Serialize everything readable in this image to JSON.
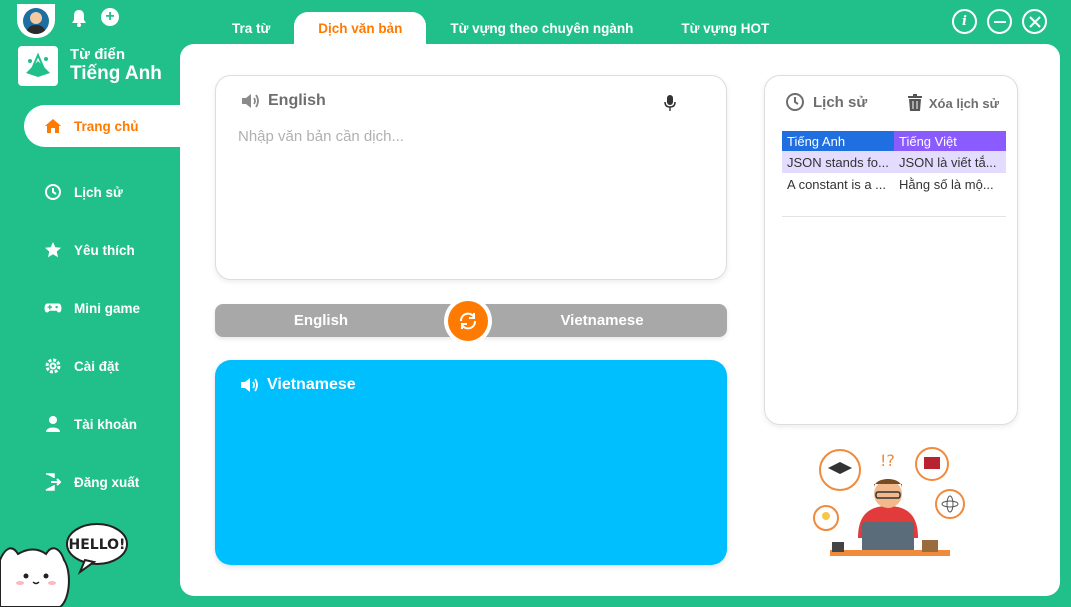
{
  "brand": {
    "line1": "Từ điển",
    "line2": "Tiếng Anh"
  },
  "sidebar": {
    "items": [
      {
        "label": "Trang chủ",
        "icon": "home-icon",
        "active": true
      },
      {
        "label": "Lịch sử",
        "icon": "history-icon"
      },
      {
        "label": "Yêu thích",
        "icon": "star-icon"
      },
      {
        "label": "Mini game",
        "icon": "gamepad-icon"
      },
      {
        "label": "Cài đặt",
        "icon": "gear-icon"
      },
      {
        "label": "Tài khoản",
        "icon": "user-icon"
      },
      {
        "label": "Đăng xuất",
        "icon": "logout-icon"
      }
    ]
  },
  "tabs": [
    {
      "label": "Tra từ"
    },
    {
      "label": "Dịch văn bản",
      "active": true
    },
    {
      "label": "Từ vựng theo chuyên ngành"
    },
    {
      "label": "Từ vựng HOT"
    }
  ],
  "translator": {
    "source_lang": "English",
    "placeholder": "Nhập văn bản cần dịch...",
    "swap_left": "English",
    "swap_right": "Vietnamese",
    "target_lang": "Vietnamese"
  },
  "history": {
    "title": "Lịch sử",
    "clear_label": "Xóa lịch sử",
    "columns": [
      "Tiếng Anh",
      "Tiếng Việt"
    ],
    "rows": [
      [
        "JSON stands fo...",
        "JSON là viết tắ..."
      ],
      [
        "A constant is a ...",
        "Hằng số là mộ..."
      ]
    ]
  },
  "cat_bubble": "HELLO!",
  "colors": {
    "primary": "#21c08b",
    "accent": "#ff7a00",
    "output": "#00bfff",
    "table_head1": "#1f6fe0",
    "table_head2": "#8a5cff"
  }
}
